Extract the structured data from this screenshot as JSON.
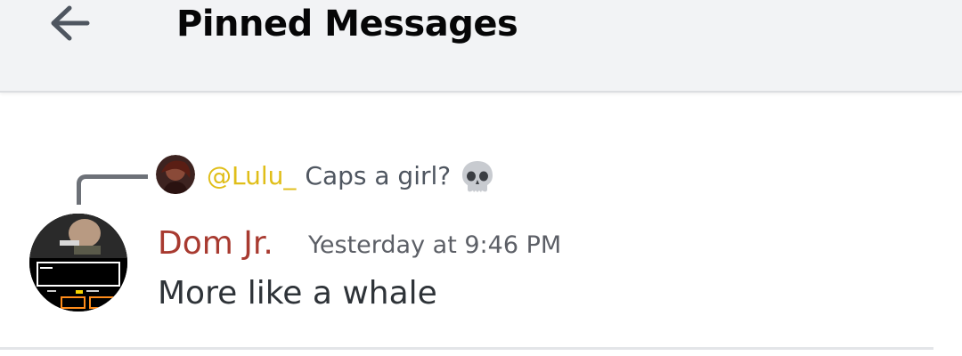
{
  "header": {
    "title": "Pinned Messages",
    "back_icon": "arrow-left-icon"
  },
  "message": {
    "reply": {
      "author": "@Lulu_",
      "text": "Caps a girl?",
      "emoji": "skull-icon",
      "author_color": "#e0be19"
    },
    "author": "Dom Jr.",
    "author_color": "#a83a30",
    "timestamp": "Yesterday at 9:46 PM",
    "content": "More like a whale"
  }
}
